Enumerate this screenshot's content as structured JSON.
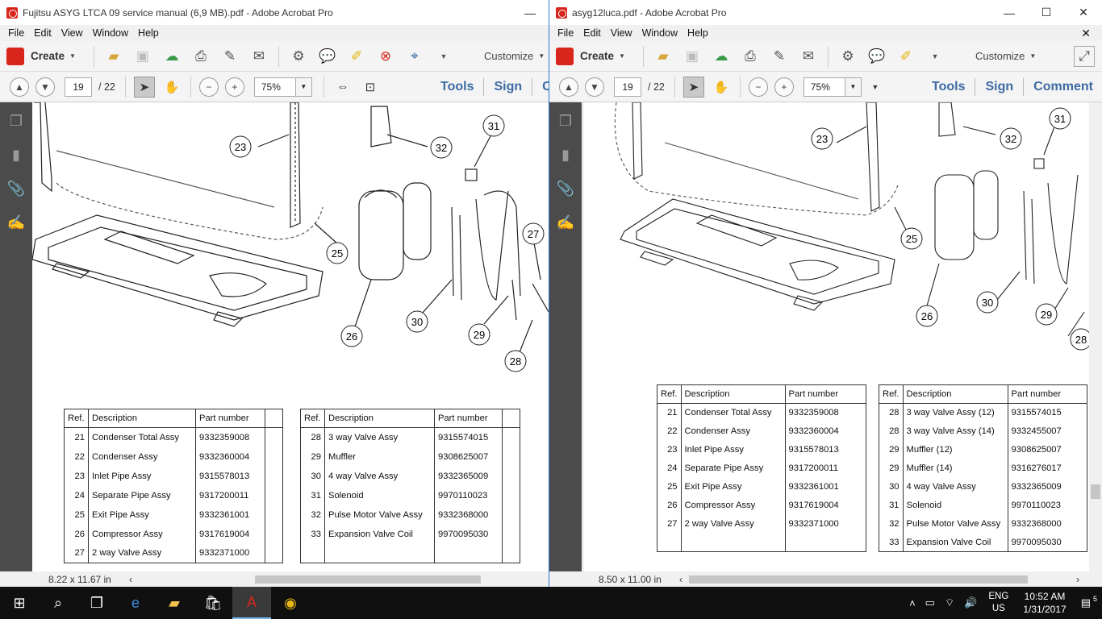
{
  "left_window": {
    "title": "Fujitsu ASYG LTCA 09 service manual (6,9 MB).pdf - Adobe Acrobat Pro",
    "menu": [
      "File",
      "Edit",
      "View",
      "Window",
      "Help"
    ],
    "create_label": "Create",
    "customize_label": "Customize",
    "page_current": "19",
    "page_total": "/ 22",
    "zoom": "75%",
    "links": [
      "Tools",
      "Sign",
      "C"
    ],
    "status_size": "8.22 x 11.67 in",
    "callouts": [
      "23",
      "32",
      "31",
      "27",
      "25",
      "30",
      "29",
      "26",
      "28"
    ],
    "table1": {
      "headers": [
        "Ref.",
        "Description",
        "Part number",
        ""
      ],
      "rows": [
        [
          "21",
          "Condenser Total Assy",
          "9332359008"
        ],
        [
          "22",
          "Condenser Assy",
          "9332360004"
        ],
        [
          "23",
          "Inlet Pipe Assy",
          "9315578013"
        ],
        [
          "24",
          "Separate Pipe Assy",
          "9317200011"
        ],
        [
          "25",
          "Exit Pipe Assy",
          "9332361001"
        ],
        [
          "26",
          "Compressor Assy",
          "9317619004"
        ],
        [
          "27",
          "2 way Valve Assy",
          "9332371000"
        ]
      ]
    },
    "table2": {
      "headers": [
        "Ref.",
        "Description",
        "Part number",
        ""
      ],
      "rows": [
        [
          "28",
          "3 way Valve Assy",
          "9315574015"
        ],
        [
          "29",
          "Muffler",
          "9308625007"
        ],
        [
          "30",
          "4 way Valve Assy",
          "9332365009"
        ],
        [
          "31",
          "Solenoid",
          "9970110023"
        ],
        [
          "32",
          "Pulse Motor Valve Assy",
          "9332368000"
        ],
        [
          "33",
          "Expansion Valve Coil",
          "9970095030"
        ],
        [
          "",
          "",
          ""
        ]
      ]
    }
  },
  "right_window": {
    "title": "asyg12luca.pdf - Adobe Acrobat Pro",
    "menu": [
      "File",
      "Edit",
      "View",
      "Window",
      "Help"
    ],
    "create_label": "Create",
    "customize_label": "Customize",
    "page_current": "19",
    "page_total": "/ 22",
    "zoom": "75%",
    "links": [
      "Tools",
      "Sign",
      "Comment"
    ],
    "status_size": "8.50 x 11.00 in",
    "callouts": [
      "31",
      "23",
      "32",
      "25",
      "26",
      "30",
      "29",
      "28"
    ],
    "table1": {
      "headers": [
        "Ref.",
        "Description",
        "Part number"
      ],
      "rows": [
        [
          "21",
          "Condenser Total Assy",
          "9332359008"
        ],
        [
          "22",
          "Condenser Assy",
          "9332360004"
        ],
        [
          "23",
          "Inlet Pipe Assy",
          "9315578013"
        ],
        [
          "24",
          "Separate Pipe Assy",
          "9317200011"
        ],
        [
          "25",
          "Exit Pipe Assy",
          "9332361001"
        ],
        [
          "26",
          "Compressor Assy",
          "9317619004"
        ],
        [
          "27",
          "2 way Valve Assy",
          "9332371000"
        ],
        [
          "",
          "",
          ""
        ]
      ]
    },
    "table2": {
      "headers": [
        "Ref.",
        "Description",
        "Part number"
      ],
      "rows": [
        [
          "28",
          "3 way Valve Assy (12)",
          "9315574015"
        ],
        [
          "28",
          "3 way Valve Assy (14)",
          "9332455007"
        ],
        [
          "29",
          "Muffler (12)",
          "9308625007"
        ],
        [
          "29",
          "Muffler (14)",
          "9316276017"
        ],
        [
          "30",
          "4 way Valve Assy",
          "9332365009"
        ],
        [
          "31",
          "Solenoid",
          "9970110023"
        ],
        [
          "32",
          "Pulse Motor Valve Assy",
          "9332368000"
        ],
        [
          "33",
          "Expansion Valve Coil",
          "9970095030"
        ]
      ]
    }
  },
  "taskbar": {
    "lang_top": "ENG",
    "lang_bottom": "US",
    "time": "10:52 AM",
    "date": "1/31/2017",
    "notification_count": "5"
  },
  "colors": {
    "accent": "#2b78d6",
    "acrobat_red": "#d9261c",
    "link_blue": "#3d6ba3"
  }
}
